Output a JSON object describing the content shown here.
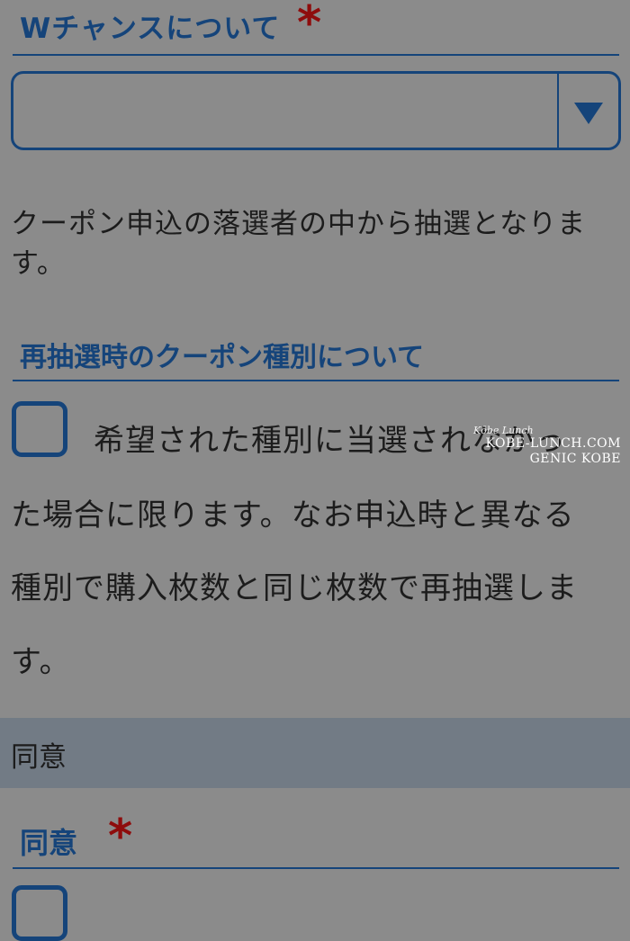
{
  "wchance_section": {
    "heading": "Wチャンスについて",
    "required_mark": "*",
    "select": {
      "selected_value": ""
    },
    "note": "クーポン申込の落選者の中から抽選となります。"
  },
  "redraw_section": {
    "heading": "再抽選時のクーポン種別について",
    "checkbox_checked": false,
    "description_lines": [
      "希望された種別に当選されなかっ",
      "た場合に限ります。なお申込時と異なる",
      "種別で購入枚数と同じ枚数で再抽選しま",
      "す。"
    ]
  },
  "consent_group": {
    "bar_label": "同意",
    "heading": "同意",
    "required_mark": "*",
    "checkbox_checked": false
  },
  "watermark": {
    "signature": "Kōbe Lunch",
    "line1": "KOBE-LUNCH.COM",
    "line2": "GENIC KOBE"
  },
  "colors": {
    "accent_navy": "#15447a",
    "required_red": "#8e0c0c",
    "overlay_gray": "#8b8b8b",
    "group_bar": "#727b85"
  }
}
